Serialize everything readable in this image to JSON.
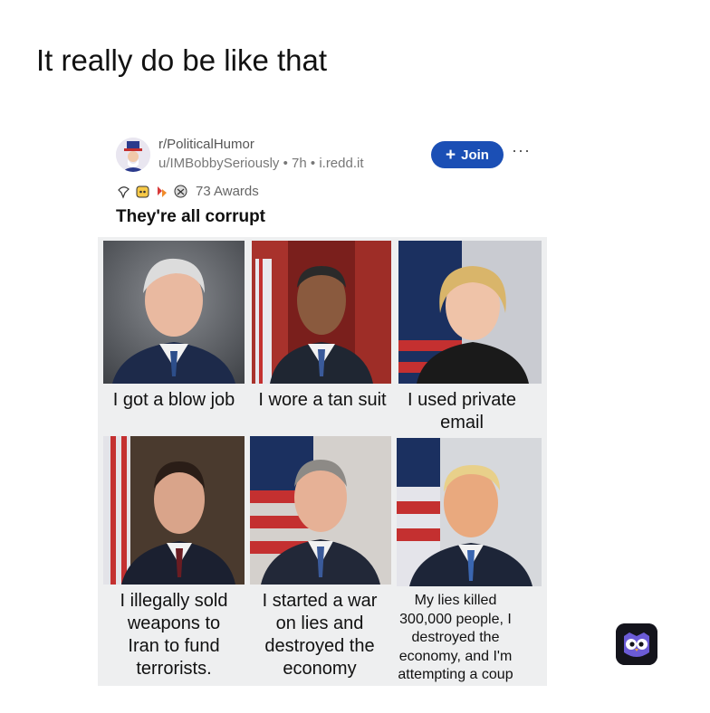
{
  "caption": "It really do be like that",
  "post": {
    "subreddit": "r/PoliticalHumor",
    "user": "u/IMBobbySeriously",
    "time": "7h",
    "domain": "i.redd.it",
    "separator": "•",
    "join_label": "Join",
    "join_icon": "+",
    "more_icon": "···",
    "awards": "73 Awards",
    "title": "They're all corrupt"
  },
  "panels": [
    {
      "caption": "I got a blow job"
    },
    {
      "caption": "I wore a tan suit"
    },
    {
      "caption_lines": [
        "I used private",
        "email"
      ]
    },
    {
      "caption_lines": [
        "I illegally sold",
        "weapons to",
        "Iran to fund",
        "terrorists."
      ]
    },
    {
      "caption_lines": [
        "I started a war",
        "on lies and",
        "destroyed the",
        "economy"
      ]
    },
    {
      "caption_lines": [
        "My lies killed",
        "300,000 people, I",
        "destroyed the",
        "economy, and I'm",
        "attempting a coup"
      ]
    }
  ],
  "colors": {
    "join_bg": "#1b4fb5",
    "grid_bg": "#eeeff0"
  },
  "icons": [
    "uncle-sam-avatar-icon",
    "award-icon",
    "app-owl-icon"
  ]
}
